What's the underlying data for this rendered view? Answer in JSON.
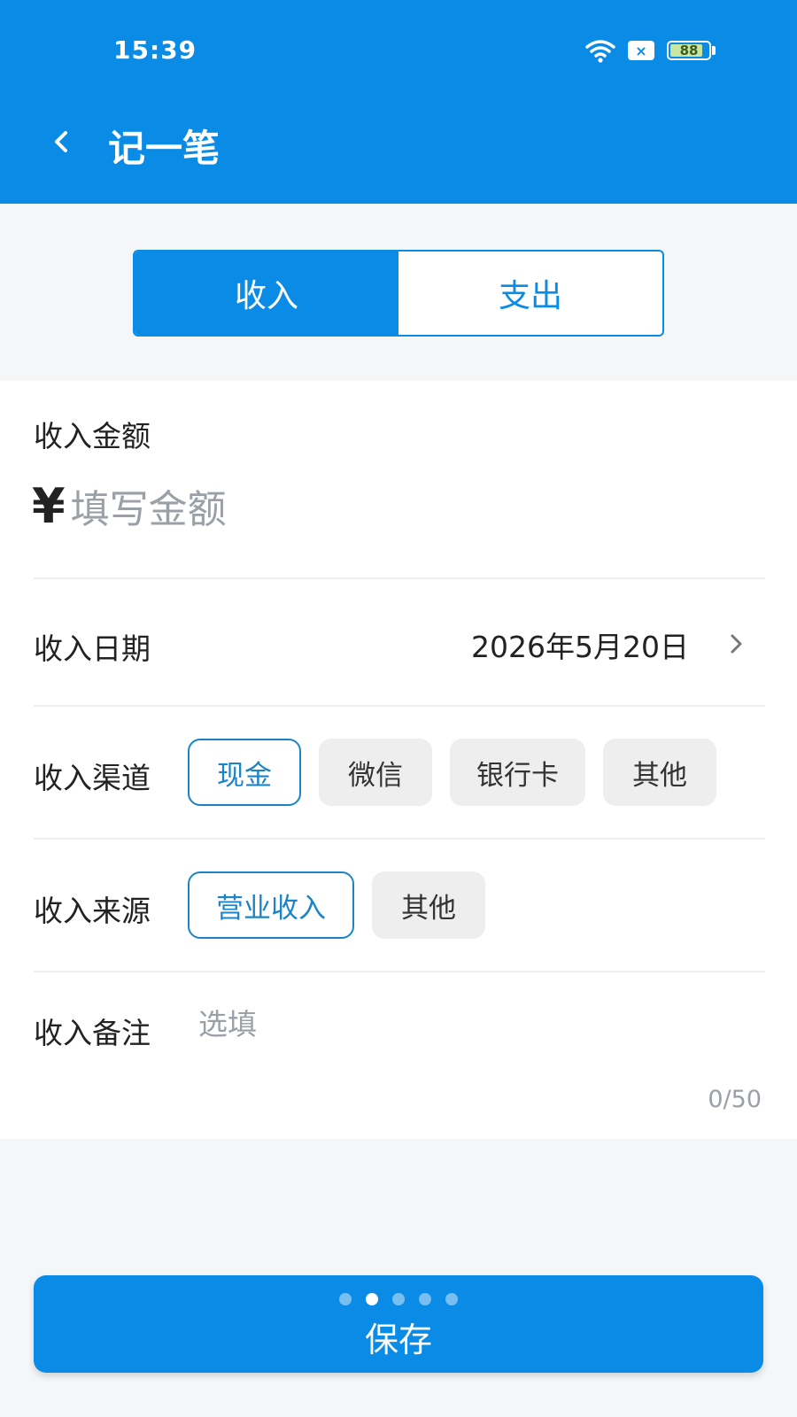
{
  "status_bar": {
    "time": "15:39",
    "battery": "88",
    "battery_level": 0.88,
    "sim_icon": "×"
  },
  "header": {
    "back_icon": "chevron-left-icon",
    "title": "记一笔"
  },
  "tabs": [
    {
      "label": "收入",
      "active": true
    },
    {
      "label": "支出",
      "active": false
    }
  ],
  "form": {
    "amount": {
      "label": "收入金额",
      "currency": "¥",
      "placeholder": "填写金额",
      "value": ""
    },
    "date": {
      "label": "收入日期",
      "value": "2026年5月20日"
    },
    "channel": {
      "label": "收入渠道",
      "options": [
        {
          "label": "现金",
          "selected": true
        },
        {
          "label": "微信",
          "selected": false
        },
        {
          "label": "银行卡",
          "selected": false
        },
        {
          "label": "其他",
          "selected": false
        }
      ]
    },
    "source": {
      "label": "收入来源",
      "options": [
        {
          "label": "营业收入",
          "selected": true
        },
        {
          "label": "其他",
          "selected": false
        }
      ]
    },
    "note": {
      "label": "收入备注",
      "placeholder": "选填",
      "counter": "0/50"
    }
  },
  "save_button": {
    "label": "保存",
    "pager_dots": 5,
    "pager_active": 1
  },
  "colors": {
    "primary": "#0a8be6",
    "chip_selected": "#1a84c7",
    "background": "#f4f6f8"
  }
}
